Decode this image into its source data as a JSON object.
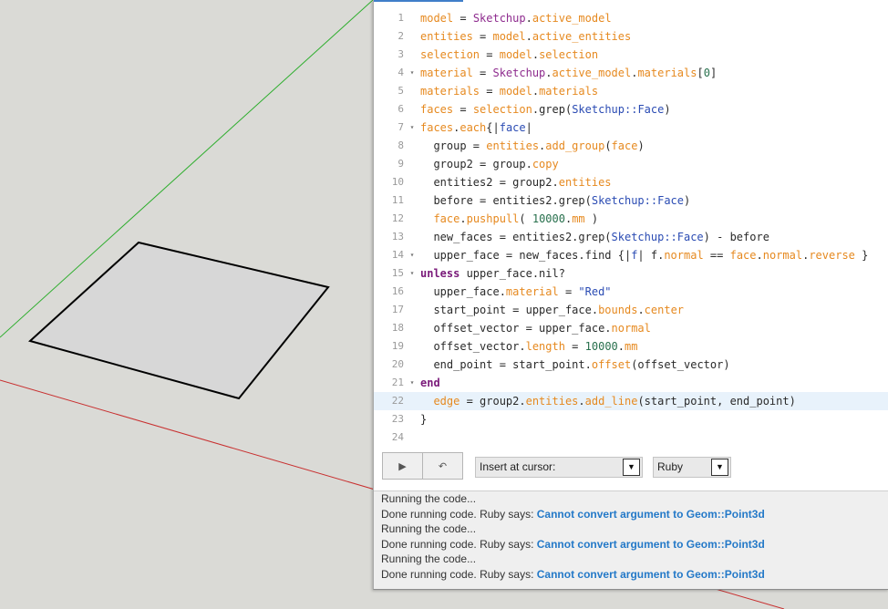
{
  "code_lines": [
    {
      "n": "1",
      "fold": "",
      "tokens": [
        [
          "model",
          "fn"
        ],
        [
          " = ",
          "plain"
        ],
        [
          "Sketchup",
          "const"
        ],
        [
          ".",
          "plain"
        ],
        [
          "active_model",
          "fn"
        ]
      ]
    },
    {
      "n": "2",
      "fold": "",
      "tokens": [
        [
          "entities",
          "fn"
        ],
        [
          " = ",
          "plain"
        ],
        [
          "model",
          "fn"
        ],
        [
          ".",
          "plain"
        ],
        [
          "active_entities",
          "fn"
        ]
      ]
    },
    {
      "n": "3",
      "fold": "",
      "tokens": [
        [
          "selection",
          "fn"
        ],
        [
          " = ",
          "plain"
        ],
        [
          "model",
          "fn"
        ],
        [
          ".",
          "plain"
        ],
        [
          "selection",
          "fn"
        ]
      ]
    },
    {
      "n": "4",
      "fold": "▾",
      "tokens": [
        [
          "material",
          "fn"
        ],
        [
          " = ",
          "plain"
        ],
        [
          "Sketchup",
          "const"
        ],
        [
          ".",
          "plain"
        ],
        [
          "active_model",
          "fn"
        ],
        [
          ".",
          "plain"
        ],
        [
          "materials",
          "fn"
        ],
        [
          "[",
          "plain"
        ],
        [
          "0",
          "num"
        ],
        [
          "]",
          "plain"
        ]
      ]
    },
    {
      "n": "5",
      "fold": "",
      "tokens": [
        [
          "materials",
          "fn"
        ],
        [
          " = ",
          "plain"
        ],
        [
          "model",
          "fn"
        ],
        [
          ".",
          "plain"
        ],
        [
          "materials",
          "fn"
        ]
      ]
    },
    {
      "n": "6",
      "fold": "",
      "tokens": [
        [
          "faces",
          "fn"
        ],
        [
          " = ",
          "plain"
        ],
        [
          "selection",
          "fn"
        ],
        [
          ".grep(",
          "plain"
        ],
        [
          "Sketchup::Face",
          "str"
        ],
        [
          ")",
          "plain"
        ]
      ]
    },
    {
      "n": "7",
      "fold": "▾",
      "tokens": [
        [
          "faces",
          "fn"
        ],
        [
          ".",
          "plain"
        ],
        [
          "each",
          "fn"
        ],
        [
          "{|",
          "plain"
        ],
        [
          "face",
          "str"
        ],
        [
          "|",
          "plain"
        ]
      ]
    },
    {
      "n": "8",
      "fold": "",
      "tokens": [
        [
          "  group = ",
          "plain"
        ],
        [
          "entities",
          "fn"
        ],
        [
          ".",
          "plain"
        ],
        [
          "add_group",
          "fn"
        ],
        [
          "(",
          "plain"
        ],
        [
          "face",
          "fn"
        ],
        [
          ")",
          "plain"
        ]
      ]
    },
    {
      "n": "9",
      "fold": "",
      "tokens": [
        [
          "  group2 = group.",
          "plain"
        ],
        [
          "copy",
          "fn"
        ]
      ]
    },
    {
      "n": "10",
      "fold": "",
      "tokens": [
        [
          "  entities2 = group2.",
          "plain"
        ],
        [
          "entities",
          "fn"
        ]
      ]
    },
    {
      "n": "11",
      "fold": "",
      "tokens": [
        [
          "  before = entities2.grep(",
          "plain"
        ],
        [
          "Sketchup::Face",
          "str"
        ],
        [
          ")",
          "plain"
        ]
      ]
    },
    {
      "n": "12",
      "fold": "",
      "tokens": [
        [
          "  ",
          "plain"
        ],
        [
          "face",
          "fn"
        ],
        [
          ".",
          "plain"
        ],
        [
          "pushpull",
          "fn"
        ],
        [
          "( ",
          "plain"
        ],
        [
          "10000",
          "num"
        ],
        [
          ".",
          "plain"
        ],
        [
          "mm",
          "fn"
        ],
        [
          " )",
          "plain"
        ]
      ]
    },
    {
      "n": "13",
      "fold": "",
      "tokens": [
        [
          "  new_faces = entities2.grep(",
          "plain"
        ],
        [
          "Sketchup::Face",
          "str"
        ],
        [
          ") - before",
          "plain"
        ]
      ]
    },
    {
      "n": "14",
      "fold": "▾",
      "tokens": [
        [
          "  upper_face = new_faces.find {|",
          "plain"
        ],
        [
          "f",
          "str"
        ],
        [
          "| f.",
          "plain"
        ],
        [
          "normal",
          "fn"
        ],
        [
          " == ",
          "plain"
        ],
        [
          "face",
          "fn"
        ],
        [
          ".",
          "plain"
        ],
        [
          "normal",
          "fn"
        ],
        [
          ".",
          "plain"
        ],
        [
          "reverse",
          "fn"
        ],
        [
          " }",
          "plain"
        ]
      ]
    },
    {
      "n": "15",
      "fold": "▾",
      "tokens": [
        [
          "unless",
          "kw"
        ],
        [
          " upper_face.nil?",
          "plain"
        ]
      ]
    },
    {
      "n": "16",
      "fold": "",
      "tokens": [
        [
          "  upper_face.",
          "plain"
        ],
        [
          "material",
          "fn"
        ],
        [
          " = ",
          "plain"
        ],
        [
          "\"Red\"",
          "str"
        ]
      ]
    },
    {
      "n": "17",
      "fold": "",
      "tokens": [
        [
          "  start_point = upper_face.",
          "plain"
        ],
        [
          "bounds",
          "fn"
        ],
        [
          ".",
          "plain"
        ],
        [
          "center",
          "fn"
        ]
      ]
    },
    {
      "n": "18",
      "fold": "",
      "tokens": [
        [
          "  offset_vector = upper_face.",
          "plain"
        ],
        [
          "normal",
          "fn"
        ]
      ]
    },
    {
      "n": "19",
      "fold": "",
      "tokens": [
        [
          "  offset_vector.",
          "plain"
        ],
        [
          "length",
          "fn"
        ],
        [
          " = ",
          "plain"
        ],
        [
          "10000",
          "num"
        ],
        [
          ".",
          "plain"
        ],
        [
          "mm",
          "fn"
        ]
      ]
    },
    {
      "n": "20",
      "fold": "",
      "tokens": [
        [
          "  end_point = start_point.",
          "plain"
        ],
        [
          "offset",
          "fn"
        ],
        [
          "(offset_vector)",
          "plain"
        ]
      ]
    },
    {
      "n": "21",
      "fold": "▾",
      "tokens": [
        [
          "end",
          "kw"
        ]
      ]
    },
    {
      "n": "22",
      "fold": "",
      "active": true,
      "tokens": [
        [
          "  ",
          "plain"
        ],
        [
          "edge",
          "fn"
        ],
        [
          " = group2.",
          "plain"
        ],
        [
          "entities",
          "fn"
        ],
        [
          ".",
          "plain"
        ],
        [
          "add_line",
          "fn"
        ],
        [
          "(start_point, end_point)",
          "plain"
        ]
      ]
    },
    {
      "n": "23",
      "fold": "",
      "tokens": [
        [
          "}",
          "plain"
        ]
      ]
    },
    {
      "n": "24",
      "fold": "",
      "tokens": []
    }
  ],
  "toolbar": {
    "run_icon": "play-icon",
    "undo_icon": "undo-icon",
    "run_glyph": "▶",
    "undo_glyph": "↶",
    "insert_label": "Insert at cursor:",
    "lang_label": "Ruby",
    "arrow_glyph": "▼"
  },
  "console": {
    "lines": [
      {
        "prefix": "Running the code...",
        "msg": ""
      },
      {
        "prefix": "Done running code. Ruby says: ",
        "msg": "Cannot convert argument to Geom::Point3d"
      },
      {
        "prefix": "Running the code...",
        "msg": ""
      },
      {
        "prefix": "Done running code. Ruby says: ",
        "msg": "Cannot convert argument to Geom::Point3d"
      },
      {
        "prefix": "Running the code...",
        "msg": ""
      },
      {
        "prefix": "Done running code. Ruby says: ",
        "msg": "Cannot convert argument to Geom::Point3d"
      }
    ]
  },
  "colors": {
    "viewport_bg": "#dadad6",
    "green_axis": "#2fae2f",
    "red_axis": "#c83030",
    "face_fill": "#d7d7d7",
    "accent": "#2479c8"
  }
}
